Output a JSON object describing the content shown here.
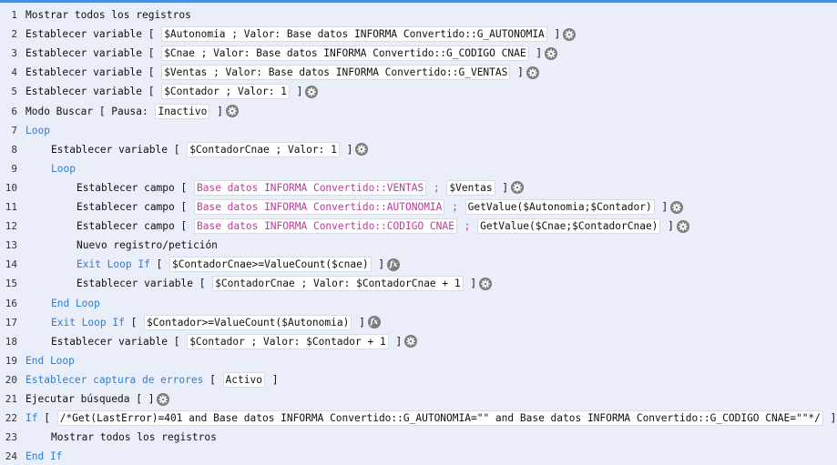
{
  "lines": [
    {
      "n": "1",
      "indent": 0,
      "parts": [
        {
          "t": "Mostrar todos los registros"
        }
      ]
    },
    {
      "n": "2",
      "indent": 0,
      "parts": [
        {
          "t": "Establecer variable [ "
        },
        {
          "t": "$Autonomia ; Valor: Base datos INFORMA Convertido::G_AUTONOMIA",
          "box": true
        },
        {
          "t": " ]"
        },
        {
          "icon": "gear-icon"
        }
      ]
    },
    {
      "n": "3",
      "indent": 0,
      "parts": [
        {
          "t": "Establecer variable [ "
        },
        {
          "t": "$Cnae ; Valor: Base datos INFORMA Convertido::G_CODIGO CNAE",
          "box": true
        },
        {
          "t": " ]"
        },
        {
          "icon": "gear-icon"
        }
      ]
    },
    {
      "n": "4",
      "indent": 0,
      "parts": [
        {
          "t": "Establecer variable [ "
        },
        {
          "t": "$Ventas ; Valor: Base datos INFORMA Convertido::G_VENTAS",
          "box": true
        },
        {
          "t": " ]"
        },
        {
          "icon": "gear-icon"
        }
      ]
    },
    {
      "n": "5",
      "indent": 0,
      "parts": [
        {
          "t": "Establecer variable [ "
        },
        {
          "t": "$Contador ; Valor: 1",
          "box": true
        },
        {
          "t": " ]"
        },
        {
          "icon": "gear-icon"
        }
      ]
    },
    {
      "n": "6",
      "indent": 0,
      "parts": [
        {
          "t": "Modo Buscar [ Pausa: "
        },
        {
          "t": "Inactivo",
          "box": true
        },
        {
          "t": " ]"
        },
        {
          "icon": "gear-icon"
        }
      ]
    },
    {
      "n": "7",
      "indent": 0,
      "parts": [
        {
          "t": "Loop",
          "kw": true
        }
      ]
    },
    {
      "n": "8",
      "indent": 1,
      "parts": [
        {
          "t": "Establecer variable [ "
        },
        {
          "t": "$ContadorCnae ; Valor: 1",
          "box": true
        },
        {
          "t": " ]"
        },
        {
          "icon": "gear-icon"
        }
      ]
    },
    {
      "n": "9",
      "indent": 1,
      "parts": [
        {
          "t": "Loop",
          "kw": true
        }
      ]
    },
    {
      "n": "10",
      "indent": 2,
      "parts": [
        {
          "t": "Establecer campo [ "
        },
        {
          "t": "Base datos INFORMA Convertido::VENTAS",
          "box": true,
          "fld": true
        },
        {
          "t": " ; ",
          "fld": true
        },
        {
          "t": "$Ventas",
          "box": true
        },
        {
          "t": " ]"
        },
        {
          "icon": "gear-icon"
        }
      ]
    },
    {
      "n": "11",
      "indent": 2,
      "parts": [
        {
          "t": "Establecer campo [ "
        },
        {
          "t": "Base datos INFORMA Convertido::AUTONOMIA",
          "box": true,
          "fld": true
        },
        {
          "t": " ; ",
          "fld": true
        },
        {
          "t": "GetValue($Autonomia;$Contador)",
          "box": true
        },
        {
          "t": " ]"
        },
        {
          "icon": "gear-icon"
        }
      ]
    },
    {
      "n": "12",
      "indent": 2,
      "parts": [
        {
          "t": "Establecer campo [ "
        },
        {
          "t": "Base datos INFORMA Convertido::CODIGO CNAE",
          "box": true,
          "fld": true
        },
        {
          "t": " ; ",
          "fld": true
        },
        {
          "t": "GetValue($Cnae;$ContadorCnae)",
          "box": true
        },
        {
          "t": " ]"
        },
        {
          "icon": "gear-icon"
        }
      ]
    },
    {
      "n": "13",
      "indent": 2,
      "parts": [
        {
          "t": "Nuevo registro/petición"
        }
      ]
    },
    {
      "n": "14",
      "indent": 2,
      "parts": [
        {
          "t": "Exit Loop If",
          "kw": true
        },
        {
          "t": " [ "
        },
        {
          "t": "$ContadorCnae>=ValueCount($cnae)",
          "box": true
        },
        {
          "t": " ]"
        },
        {
          "icon": "fx-icon"
        }
      ]
    },
    {
      "n": "15",
      "indent": 2,
      "parts": [
        {
          "t": "Establecer variable [ "
        },
        {
          "t": "$ContadorCnae ; Valor: $ContadorCnae + 1",
          "box": true
        },
        {
          "t": " ]"
        },
        {
          "icon": "gear-icon"
        }
      ]
    },
    {
      "n": "16",
      "indent": 1,
      "parts": [
        {
          "t": "End Loop",
          "kw": true
        }
      ]
    },
    {
      "n": "17",
      "indent": 1,
      "parts": [
        {
          "t": "Exit Loop If",
          "kw": true
        },
        {
          "t": " [ "
        },
        {
          "t": "$Contador>=ValueCount($Autonomia)",
          "box": true
        },
        {
          "t": " ]"
        },
        {
          "icon": "fx-icon"
        }
      ]
    },
    {
      "n": "18",
      "indent": 1,
      "parts": [
        {
          "t": "Establecer variable [ "
        },
        {
          "t": "$Contador ; Valor: $Contador + 1",
          "box": true
        },
        {
          "t": " ]"
        },
        {
          "icon": "gear-icon"
        }
      ]
    },
    {
      "n": "19",
      "indent": 0,
      "parts": [
        {
          "t": "End Loop",
          "kw": true
        }
      ]
    },
    {
      "n": "20",
      "indent": 0,
      "parts": [
        {
          "t": "Establecer captura de errores",
          "kw": true
        },
        {
          "t": " [ "
        },
        {
          "t": "Activo",
          "box": true
        },
        {
          "t": " ]"
        }
      ]
    },
    {
      "n": "21",
      "indent": 0,
      "parts": [
        {
          "t": "Ejecutar búsqueda [ ]"
        },
        {
          "icon": "gear-icon"
        }
      ]
    },
    {
      "n": "22",
      "indent": 0,
      "parts": [
        {
          "t": "If",
          "kw": true
        },
        {
          "t": " [ "
        },
        {
          "t": "/*Get(LastError)=401 and Base datos INFORMA Convertido::G_AUTONOMIA=\"\" and Base datos INFORMA Convertido::G_CODIGO CNAE=\"\"*/",
          "box": true
        },
        {
          "t": " ]"
        },
        {
          "icon": "fx-icon"
        }
      ]
    },
    {
      "n": "23",
      "indent": 1,
      "parts": [
        {
          "t": "Mostrar todos los registros"
        }
      ]
    },
    {
      "n": "24",
      "indent": 0,
      "parts": [
        {
          "t": "End If",
          "kw": true
        }
      ]
    }
  ]
}
